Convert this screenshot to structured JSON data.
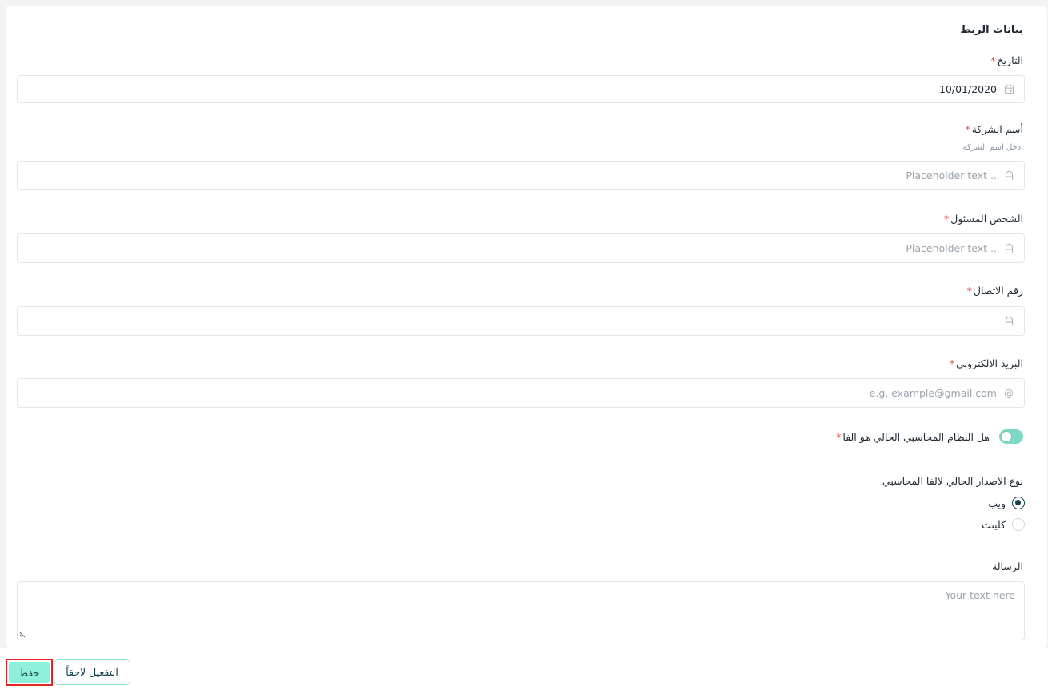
{
  "section": {
    "title": "بيانات الربط"
  },
  "fields": {
    "date": {
      "label": "التاريخ",
      "value": "10/01/2020",
      "icon": "calendar-icon",
      "required": "*"
    },
    "company": {
      "label": "أسم الشركة",
      "hint": "ادخل اسم الشركة",
      "placeholder": ".. Placeholder text",
      "icon": "text-icon",
      "required": "*"
    },
    "person": {
      "label": "الشخص المسئول",
      "placeholder": ".. Placeholder text",
      "icon": "text-icon",
      "required": "*"
    },
    "phone": {
      "label": "رقم الاتصال",
      "placeholder": "",
      "icon": "text-icon",
      "required": "*"
    },
    "email": {
      "label": "البريد الالكتروني",
      "placeholder": "e.g. example@gmail.com",
      "icon": "at-icon",
      "required": "*"
    }
  },
  "toggle": {
    "label": "هل النظام المحاسبي الحالي هو الفا",
    "required": "*",
    "on": true
  },
  "version": {
    "label": "نوع الاصدار الحالي لالفا المحاسبي",
    "options": [
      {
        "label": "ويب",
        "checked": true
      },
      {
        "label": "كلينت",
        "checked": false
      }
    ]
  },
  "message": {
    "label": "الرسالة",
    "placeholder": "Your text here"
  },
  "footer": {
    "save_label": "حفظ",
    "later_label": "التفعيل لاحقاً"
  },
  "colors": {
    "accent": "#8ff0da",
    "required": "#e5534b",
    "toggle": "#7ed9c7",
    "radio": "#0f3d4a"
  }
}
